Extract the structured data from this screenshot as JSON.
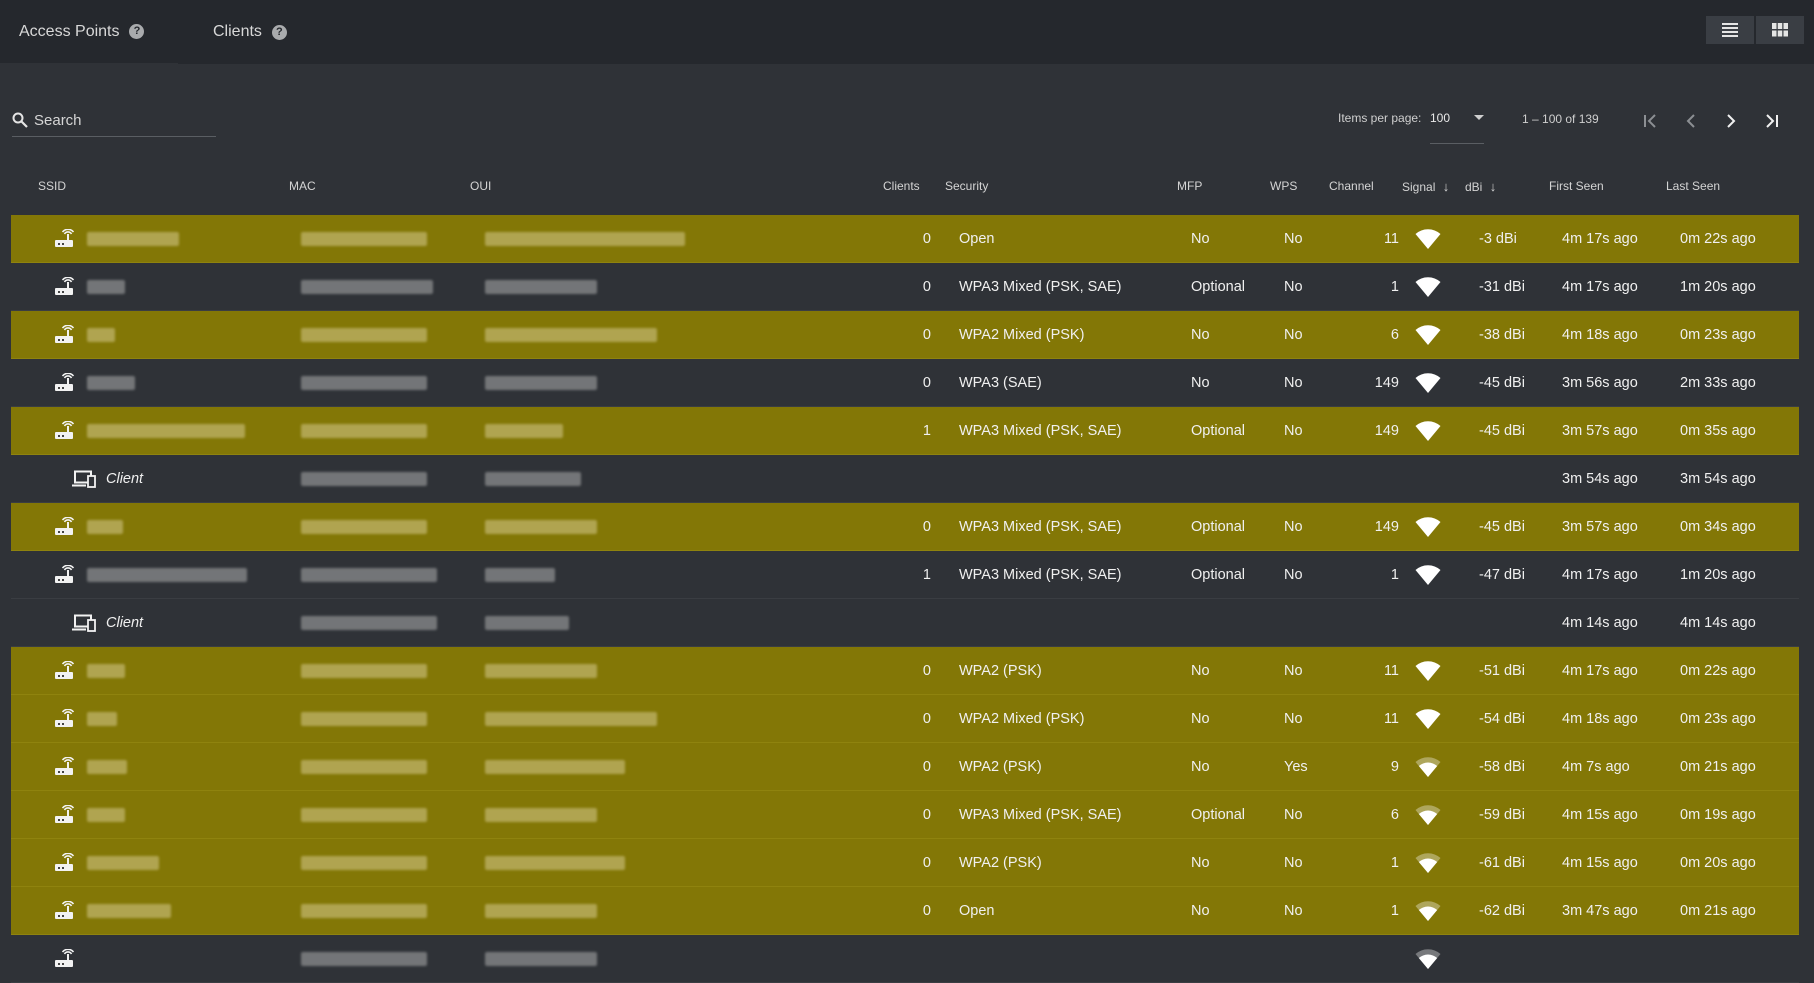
{
  "tabs": [
    {
      "label": "Access Points"
    },
    {
      "label": "Clients"
    }
  ],
  "toolbar": {
    "search_placeholder": "Search",
    "items_per_page_label": "Items per page:",
    "items_per_page_value": "100",
    "range_label": "1 – 100 of 139"
  },
  "columns": {
    "ssid": "SSID",
    "mac": "MAC",
    "oui": "OUI",
    "clients": "Clients",
    "security": "Security",
    "mfp": "MFP",
    "wps": "WPS",
    "channel": "Channel",
    "signal": "Signal",
    "dbi": "dBi",
    "first_seen": "First Seen",
    "last_seen": "Last Seen"
  },
  "colors": {
    "highlight_row": "#837706",
    "background": "#2f3237",
    "topbar": "#25282d"
  },
  "rows": [
    {
      "type": "ap",
      "highlight": true,
      "clients": "0",
      "security": "Open",
      "mfp": "No",
      "wps": "No",
      "channel": "11",
      "signal_level": 4,
      "dbi": "-3 dBi",
      "first_seen": "4m 17s ago",
      "last_seen": "0m 22s ago"
    },
    {
      "type": "ap",
      "highlight": false,
      "clients": "0",
      "security": "WPA3 Mixed (PSK, SAE)",
      "mfp": "Optional",
      "wps": "No",
      "channel": "1",
      "signal_level": 4,
      "dbi": "-31 dBi",
      "first_seen": "4m 17s ago",
      "last_seen": "1m 20s ago"
    },
    {
      "type": "ap",
      "highlight": true,
      "clients": "0",
      "security": "WPA2 Mixed (PSK)",
      "mfp": "No",
      "wps": "No",
      "channel": "6",
      "signal_level": 4,
      "dbi": "-38 dBi",
      "first_seen": "4m 18s ago",
      "last_seen": "0m 23s ago"
    },
    {
      "type": "ap",
      "highlight": false,
      "clients": "0",
      "security": "WPA3 (SAE)",
      "mfp": "No",
      "wps": "No",
      "channel": "149",
      "signal_level": 4,
      "dbi": "-45 dBi",
      "first_seen": "3m 56s ago",
      "last_seen": "2m 33s ago"
    },
    {
      "type": "ap",
      "highlight": true,
      "clients": "1",
      "security": "WPA3 Mixed (PSK, SAE)",
      "mfp": "Optional",
      "wps": "No",
      "channel": "149",
      "signal_level": 4,
      "dbi": "-45 dBi",
      "first_seen": "3m 57s ago",
      "last_seen": "0m 35s ago"
    },
    {
      "type": "client",
      "highlight": false,
      "label": "Client",
      "first_seen": "3m 54s ago",
      "last_seen": "3m 54s ago"
    },
    {
      "type": "ap",
      "highlight": true,
      "clients": "0",
      "security": "WPA3 Mixed (PSK, SAE)",
      "mfp": "Optional",
      "wps": "No",
      "channel": "149",
      "signal_level": 4,
      "dbi": "-45 dBi",
      "first_seen": "3m 57s ago",
      "last_seen": "0m 34s ago"
    },
    {
      "type": "ap",
      "highlight": false,
      "clients": "1",
      "security": "WPA3 Mixed (PSK, SAE)",
      "mfp": "Optional",
      "wps": "No",
      "channel": "1",
      "signal_level": 4,
      "dbi": "-47 dBi",
      "first_seen": "4m 17s ago",
      "last_seen": "1m 20s ago"
    },
    {
      "type": "client",
      "highlight": false,
      "label": "Client",
      "first_seen": "4m 14s ago",
      "last_seen": "4m 14s ago"
    },
    {
      "type": "ap",
      "highlight": true,
      "clients": "0",
      "security": "WPA2 (PSK)",
      "mfp": "No",
      "wps": "No",
      "channel": "11",
      "signal_level": 4,
      "dbi": "-51 dBi",
      "first_seen": "4m 17s ago",
      "last_seen": "0m 22s ago"
    },
    {
      "type": "ap",
      "highlight": true,
      "clients": "0",
      "security": "WPA2 Mixed (PSK)",
      "mfp": "No",
      "wps": "No",
      "channel": "11",
      "signal_level": 4,
      "dbi": "-54 dBi",
      "first_seen": "4m 18s ago",
      "last_seen": "0m 23s ago"
    },
    {
      "type": "ap",
      "highlight": true,
      "clients": "0",
      "security": "WPA2 (PSK)",
      "mfp": "No",
      "wps": "Yes",
      "channel": "9",
      "signal_level": 3,
      "dbi": "-58 dBi",
      "first_seen": "4m 7s ago",
      "last_seen": "0m 21s ago"
    },
    {
      "type": "ap",
      "highlight": true,
      "clients": "0",
      "security": "WPA3 Mixed (PSK, SAE)",
      "mfp": "Optional",
      "wps": "No",
      "channel": "6",
      "signal_level": 3,
      "dbi": "-59 dBi",
      "first_seen": "4m 15s ago",
      "last_seen": "0m 19s ago"
    },
    {
      "type": "ap",
      "highlight": true,
      "clients": "0",
      "security": "WPA2 (PSK)",
      "mfp": "No",
      "wps": "No",
      "channel": "1",
      "signal_level": 3,
      "dbi": "-61 dBi",
      "first_seen": "4m 15s ago",
      "last_seen": "0m 20s ago"
    },
    {
      "type": "ap",
      "highlight": true,
      "clients": "0",
      "security": "Open",
      "mfp": "No",
      "wps": "No",
      "channel": "1",
      "signal_level": 3,
      "dbi": "-62 dBi",
      "first_seen": "3m 47s ago",
      "last_seen": "0m 21s ago"
    },
    {
      "type": "ap",
      "highlight": false,
      "clients": "",
      "security": "",
      "mfp": "",
      "wps": "",
      "channel": "",
      "signal_level": 3,
      "dbi": "",
      "first_seen": "",
      "last_seen": ""
    }
  ]
}
